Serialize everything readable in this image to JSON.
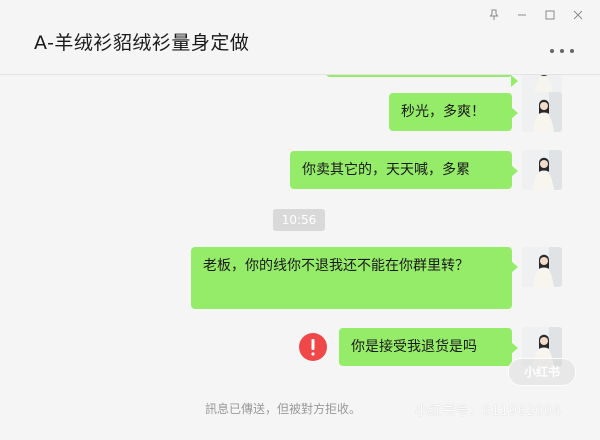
{
  "window": {
    "controls": [
      "pin-icon",
      "minimize-icon",
      "maximize-icon",
      "close-icon"
    ]
  },
  "header": {
    "title": "A-羊绒衫貂绒衫量身定做",
    "more_icon": "more-icon"
  },
  "messages": [
    {
      "type": "outgoing",
      "text": ""
    },
    {
      "type": "outgoing",
      "text": "秒光，多爽！"
    },
    {
      "type": "outgoing",
      "text": "你卖其它的，天天喊，多累"
    },
    {
      "type": "time",
      "text": "10:56"
    },
    {
      "type": "outgoing",
      "text": "老板，你的线你不退我还不能在你群里转？"
    },
    {
      "type": "outgoing",
      "status": "failed",
      "text": "你是接受我退货是吗"
    }
  ],
  "status": {
    "rejected_text": "訊息已傳送，但被對方拒收。"
  },
  "watermark": {
    "badge": "小红书",
    "account": "小红书号：611962094"
  },
  "colors": {
    "bubble": "#95ec69",
    "background": "#f5f5f5",
    "error": "#f04848"
  }
}
